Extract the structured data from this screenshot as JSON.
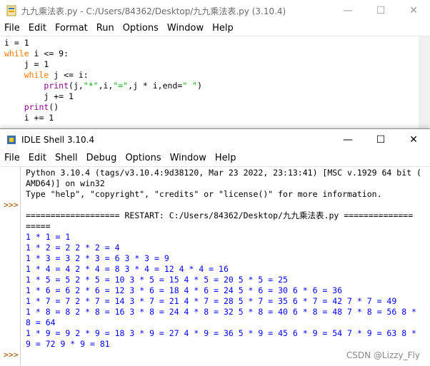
{
  "editor": {
    "title": "九九乘法表.py - C:/Users/84362/Desktop/九九乘法表.py (3.10.4)",
    "menu": [
      "File",
      "Edit",
      "Format",
      "Run",
      "Options",
      "Window",
      "Help"
    ],
    "lines": [
      {
        "parts": [
          {
            "t": "i = 1",
            "c": ""
          }
        ]
      },
      {
        "parts": [
          {
            "t": "while",
            "c": "kw"
          },
          {
            "t": " i <= 9:",
            "c": ""
          }
        ]
      },
      {
        "parts": [
          {
            "t": "    j = 1",
            "c": ""
          }
        ]
      },
      {
        "parts": [
          {
            "t": "    ",
            "c": ""
          },
          {
            "t": "while",
            "c": "kw"
          },
          {
            "t": " j <= i:",
            "c": ""
          }
        ]
      },
      {
        "parts": [
          {
            "t": "        ",
            "c": ""
          },
          {
            "t": "print",
            "c": "bi"
          },
          {
            "t": "(j,",
            "c": ""
          },
          {
            "t": "\"*\"",
            "c": "str"
          },
          {
            "t": ",i,",
            "c": ""
          },
          {
            "t": "\"=\"",
            "c": "str"
          },
          {
            "t": ",j * i,end=",
            "c": ""
          },
          {
            "t": "\" \"",
            "c": "str"
          },
          {
            "t": ")",
            "c": ""
          }
        ]
      },
      {
        "parts": [
          {
            "t": "        j += 1",
            "c": ""
          }
        ]
      },
      {
        "parts": [
          {
            "t": "    ",
            "c": ""
          },
          {
            "t": "print",
            "c": "bi"
          },
          {
            "t": "()",
            "c": ""
          }
        ]
      },
      {
        "parts": [
          {
            "t": "    i += 1",
            "c": ""
          }
        ]
      }
    ]
  },
  "shell": {
    "title": "IDLE Shell 3.10.4",
    "menu": [
      "File",
      "Edit",
      "Shell",
      "Debug",
      "Options",
      "Window",
      "Help"
    ],
    "prompt": ">>>",
    "header_lines": [
      "Python 3.10.4 (tags/v3.10.4:9d38120, Mar 23 2022, 23:13:41) [MSC v.1929 64 bit (",
      "AMD64)] on win32",
      "Type \"help\", \"copyright\", \"credits\" or \"license()\" for more information."
    ],
    "restart_lines": [
      "=================== RESTART: C:/Users/84362/Desktop/九九乘法表.py ==============",
      "====="
    ],
    "output_lines": [
      "1 * 1 = 1",
      "1 * 2 = 2 2 * 2 = 4",
      "1 * 3 = 3 2 * 3 = 6 3 * 3 = 9",
      "1 * 4 = 4 2 * 4 = 8 3 * 4 = 12 4 * 4 = 16",
      "1 * 5 = 5 2 * 5 = 10 3 * 5 = 15 4 * 5 = 20 5 * 5 = 25",
      "1 * 6 = 6 2 * 6 = 12 3 * 6 = 18 4 * 6 = 24 5 * 6 = 30 6 * 6 = 36",
      "1 * 7 = 7 2 * 7 = 14 3 * 7 = 21 4 * 7 = 28 5 * 7 = 35 6 * 7 = 42 7 * 7 = 49",
      "1 * 8 = 8 2 * 8 = 16 3 * 8 = 24 4 * 8 = 32 5 * 8 = 40 6 * 8 = 48 7 * 8 = 56 8 *",
      "8 = 64",
      "1 * 9 = 9 2 * 9 = 18 3 * 9 = 27 4 * 9 = 36 5 * 9 = 45 6 * 9 = 54 7 * 9 = 63 8 *",
      "9 = 72 9 * 9 = 81"
    ]
  },
  "controls": {
    "minimize": "—",
    "maximize": "☐",
    "close": "✕"
  },
  "watermark": "CSDN @Lizzy_Fly"
}
